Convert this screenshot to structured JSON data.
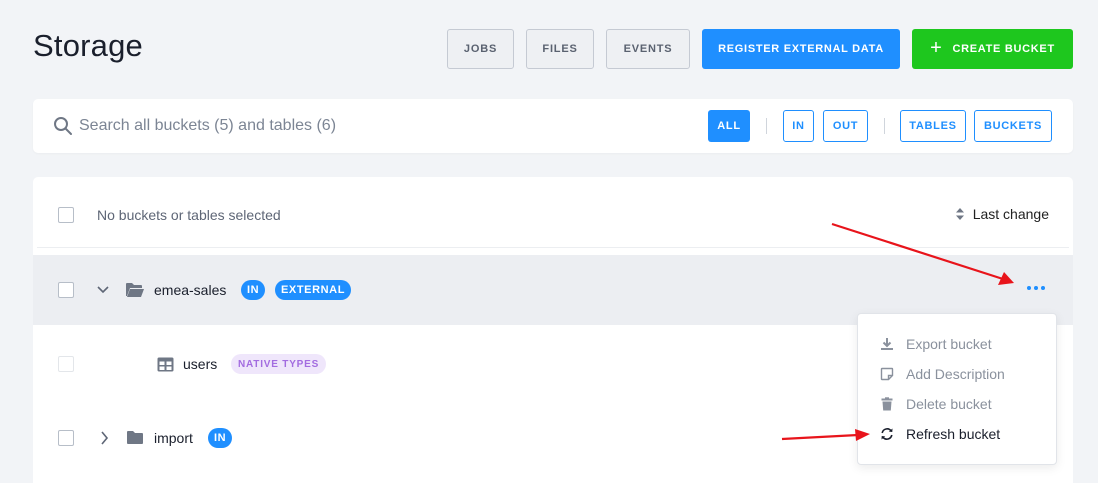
{
  "page": {
    "title": "Storage"
  },
  "top_actions": {
    "jobs": "JOBS",
    "files": "FILES",
    "events": "EVENTS",
    "register": "REGISTER EXTERNAL DATA",
    "create": "CREATE BUCKET"
  },
  "search": {
    "placeholder": "Search all buckets (5) and tables (6)",
    "filters": {
      "all": "ALL",
      "in": "IN",
      "out": "OUT",
      "tables": "TABLES",
      "buckets": "BUCKETS"
    }
  },
  "list": {
    "selection_label": "No buckets or tables selected",
    "sort_label": "Last change",
    "rows": [
      {
        "name": "emea-sales",
        "badges": [
          "IN",
          "EXTERNAL"
        ]
      },
      {
        "name": "users",
        "badges": [
          "NATIVE TYPES"
        ]
      },
      {
        "name": "import",
        "badges": [
          "IN"
        ]
      }
    ]
  },
  "context_menu": {
    "items": [
      "Export bucket",
      "Add Description",
      "Delete bucket",
      "Refresh bucket"
    ]
  },
  "colors": {
    "primary": "#1f8fff",
    "success": "#1ec71e",
    "annotation": "#e8141b"
  }
}
